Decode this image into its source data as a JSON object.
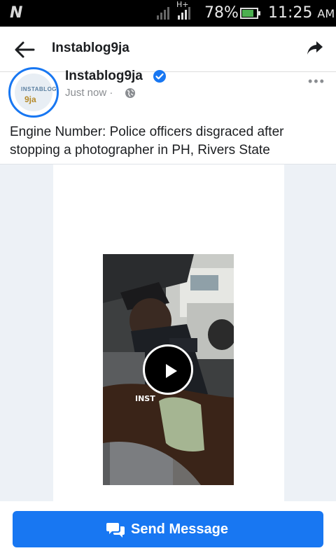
{
  "status_bar": {
    "network": "H+",
    "battery_percent": "78%",
    "battery_level": 0.78,
    "time": "11:25",
    "ampm": "AM"
  },
  "app_bar": {
    "title": "Instablog9ja",
    "back_icon": "arrow-left-icon",
    "share_icon": "share-arrow-icon"
  },
  "post": {
    "page_name": "Instablog9ja",
    "timestamp": "Just now",
    "separator": "·",
    "audience_icon": "globe-icon",
    "verified_icon": "verified-badge-icon",
    "more_label": "•••",
    "caption": "Engine Number: Police officers disgraced after stopping a photographer in PH, Rivers State",
    "avatar_text_top": "INSTABLOG",
    "avatar_text_bottom": "9ja",
    "video_overlay_text": "INST"
  },
  "footer": {
    "send_message_label": "Send Message",
    "send_icon": "messenger-chat-icon"
  },
  "colors": {
    "accent": "#1877f2",
    "status_bar_bg": "#000000",
    "battery_green": "#4caf50"
  }
}
